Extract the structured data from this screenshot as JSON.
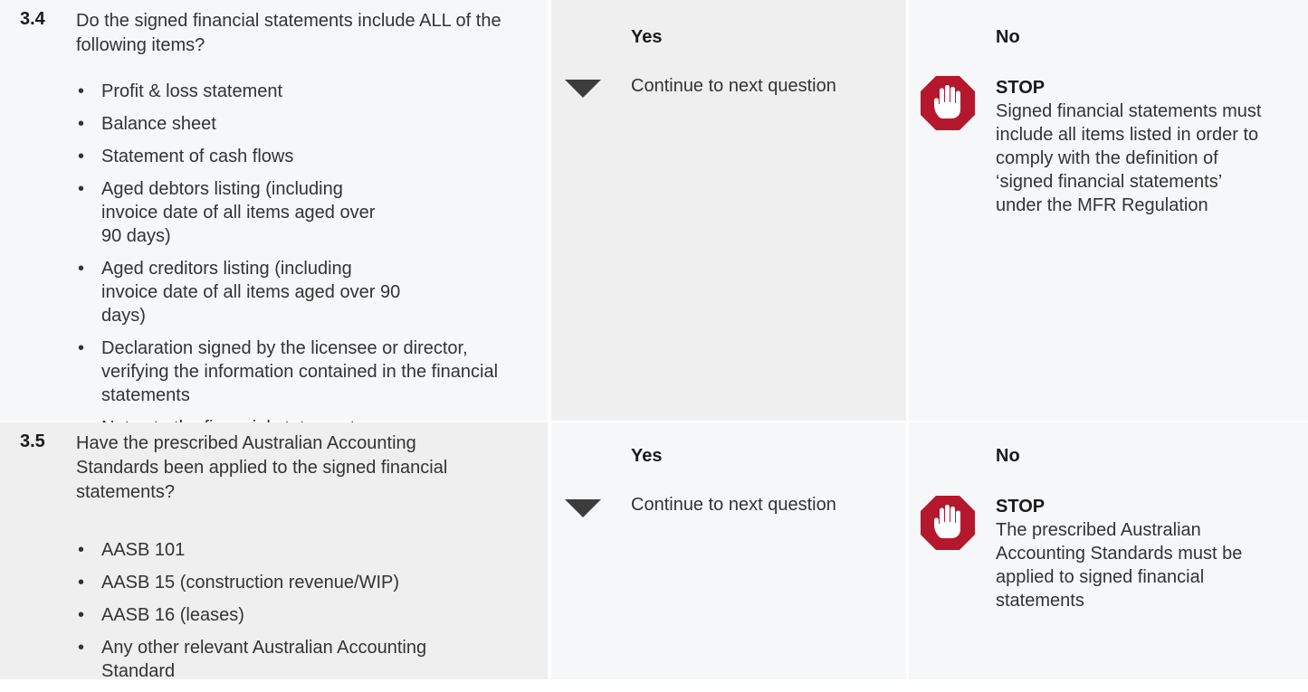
{
  "rows": [
    {
      "number": "3.4",
      "question": "Do the signed financial statements include ALL of the following items?",
      "items": [
        "Profit & loss statement",
        "Balance sheet",
        "Statement of cash flows",
        "Aged debtors listing (including invoice date of all items aged over 90 days)",
        "Aged creditors listing (including invoice date of all items aged over 90 days)",
        "Declaration signed by the licensee or director, verifying the information contained in the financial statements",
        "Notes to the financial statements"
      ],
      "yes_label": "Yes",
      "yes_text": "Continue to next question",
      "no_label": "No",
      "stop_label": "STOP",
      "stop_text": "Signed financial statements must include all items listed in order to comply with the definition of ‘signed financial statements’ under the MFR Regulation"
    },
    {
      "number": "3.5",
      "question": "Have the prescribed Australian Accounting Standards been applied to the signed financial statements?",
      "items": [
        "AASB 101",
        "AASB 15 (construction revenue/WIP)",
        "AASB 16 (leases)",
        "Any other relevant Australian Accounting Standard"
      ],
      "yes_label": "Yes",
      "yes_text": "Continue to next question",
      "no_label": "No",
      "stop_label": "STOP",
      "stop_text": "The prescribed Australian Accounting Standards must be applied to signed financial statements"
    }
  ],
  "colors": {
    "stop_icon": "#b5182d",
    "arrow": "#3c3c3c"
  },
  "icons": {
    "arrow": "down-triangle-icon",
    "stop": "stop-hand-icon"
  }
}
